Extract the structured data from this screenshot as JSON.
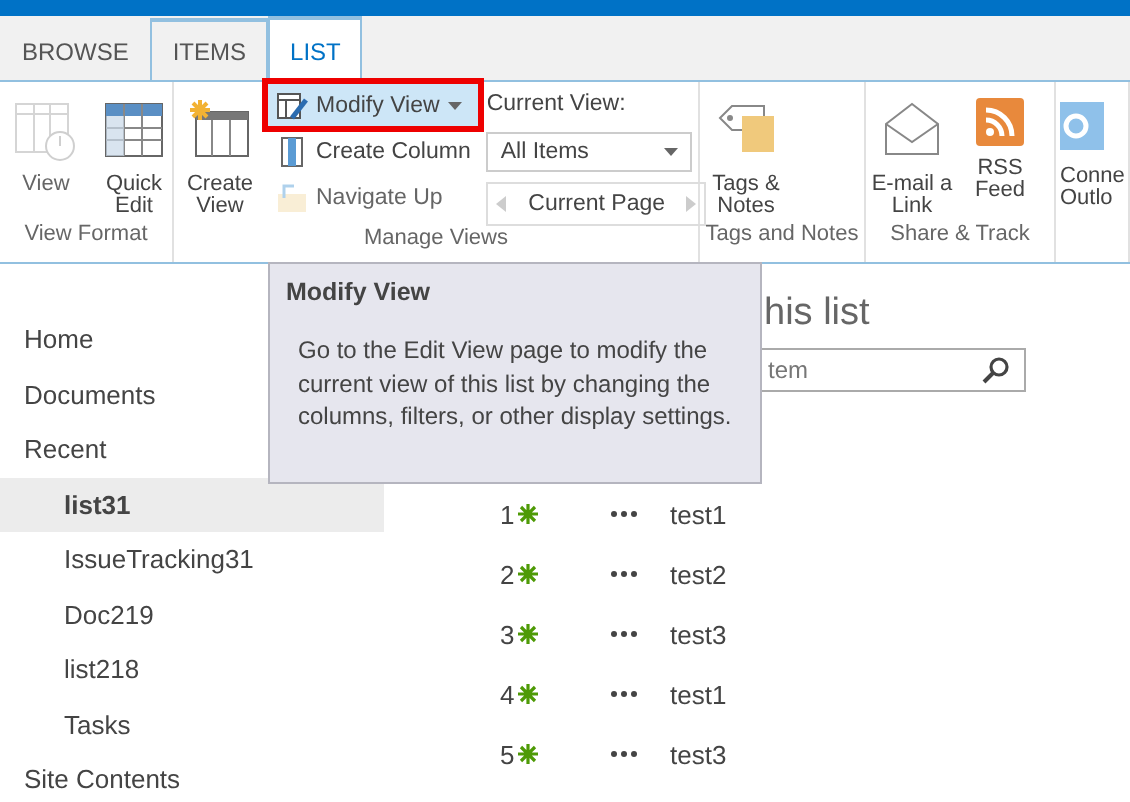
{
  "tabs": [
    {
      "label": "BROWSE",
      "selected": false,
      "framed": false
    },
    {
      "label": "ITEMS",
      "selected": false,
      "framed": true
    },
    {
      "label": "LIST",
      "selected": true,
      "framed": true
    }
  ],
  "ribbon": {
    "groups": [
      {
        "label": "View Format",
        "items": [
          {
            "kind": "large",
            "label": "View",
            "disabled": true
          },
          {
            "kind": "large",
            "label": "Quick Edit",
            "disabled": false
          }
        ]
      },
      {
        "label": "Manage Views",
        "items": [
          {
            "kind": "large",
            "label": "Create View",
            "disabled": false
          },
          {
            "kind": "stack",
            "buttons": [
              {
                "label": "Modify View",
                "highlighted": true,
                "disabled": false
              },
              {
                "label": "Create Column",
                "highlighted": false,
                "disabled": false
              },
              {
                "label": "Navigate Up",
                "highlighted": false,
                "disabled": true
              }
            ]
          },
          {
            "kind": "picker",
            "label": "Current View:",
            "value": "All Items",
            "pager": "Current Page"
          }
        ]
      },
      {
        "label": "Tags and Notes",
        "items": [
          {
            "kind": "large",
            "label": "Tags & Notes",
            "disabled": false
          }
        ]
      },
      {
        "label": "Share & Track",
        "items": [
          {
            "kind": "large",
            "label": "E-mail a Link",
            "disabled": false
          },
          {
            "kind": "large",
            "label": "RSS Feed",
            "disabled": false
          }
        ]
      },
      {
        "items": [
          {
            "kind": "large",
            "label": "Conne Outlo",
            "disabled": false
          }
        ]
      }
    ]
  },
  "tooltip": {
    "title": "Modify View",
    "body": "Go to the Edit View page to modify the current view of this list by changing the columns, filters, or other display settings."
  },
  "nav": [
    {
      "label": "Home",
      "selected": false
    },
    {
      "label": "Documents",
      "selected": false
    },
    {
      "label": "Recent",
      "selected": false,
      "children": [
        {
          "label": "list31",
          "selected": true
        },
        {
          "label": "IssueTracking31",
          "selected": false
        },
        {
          "label": "Doc219",
          "selected": false
        },
        {
          "label": "list218",
          "selected": false
        },
        {
          "label": "Tasks",
          "selected": false
        }
      ]
    },
    {
      "label": "Site Contents",
      "selected": false
    }
  ],
  "content": {
    "title": "his list",
    "search": {
      "placeholder": "tem"
    },
    "rows": [
      {
        "number": "1",
        "new": true,
        "title": "test1"
      },
      {
        "number": "2",
        "new": true,
        "title": "test2"
      },
      {
        "number": "3",
        "new": true,
        "title": "test3"
      },
      {
        "number": "4",
        "new": true,
        "title": "test1"
      },
      {
        "number": "5",
        "new": true,
        "title": "test3"
      }
    ]
  }
}
